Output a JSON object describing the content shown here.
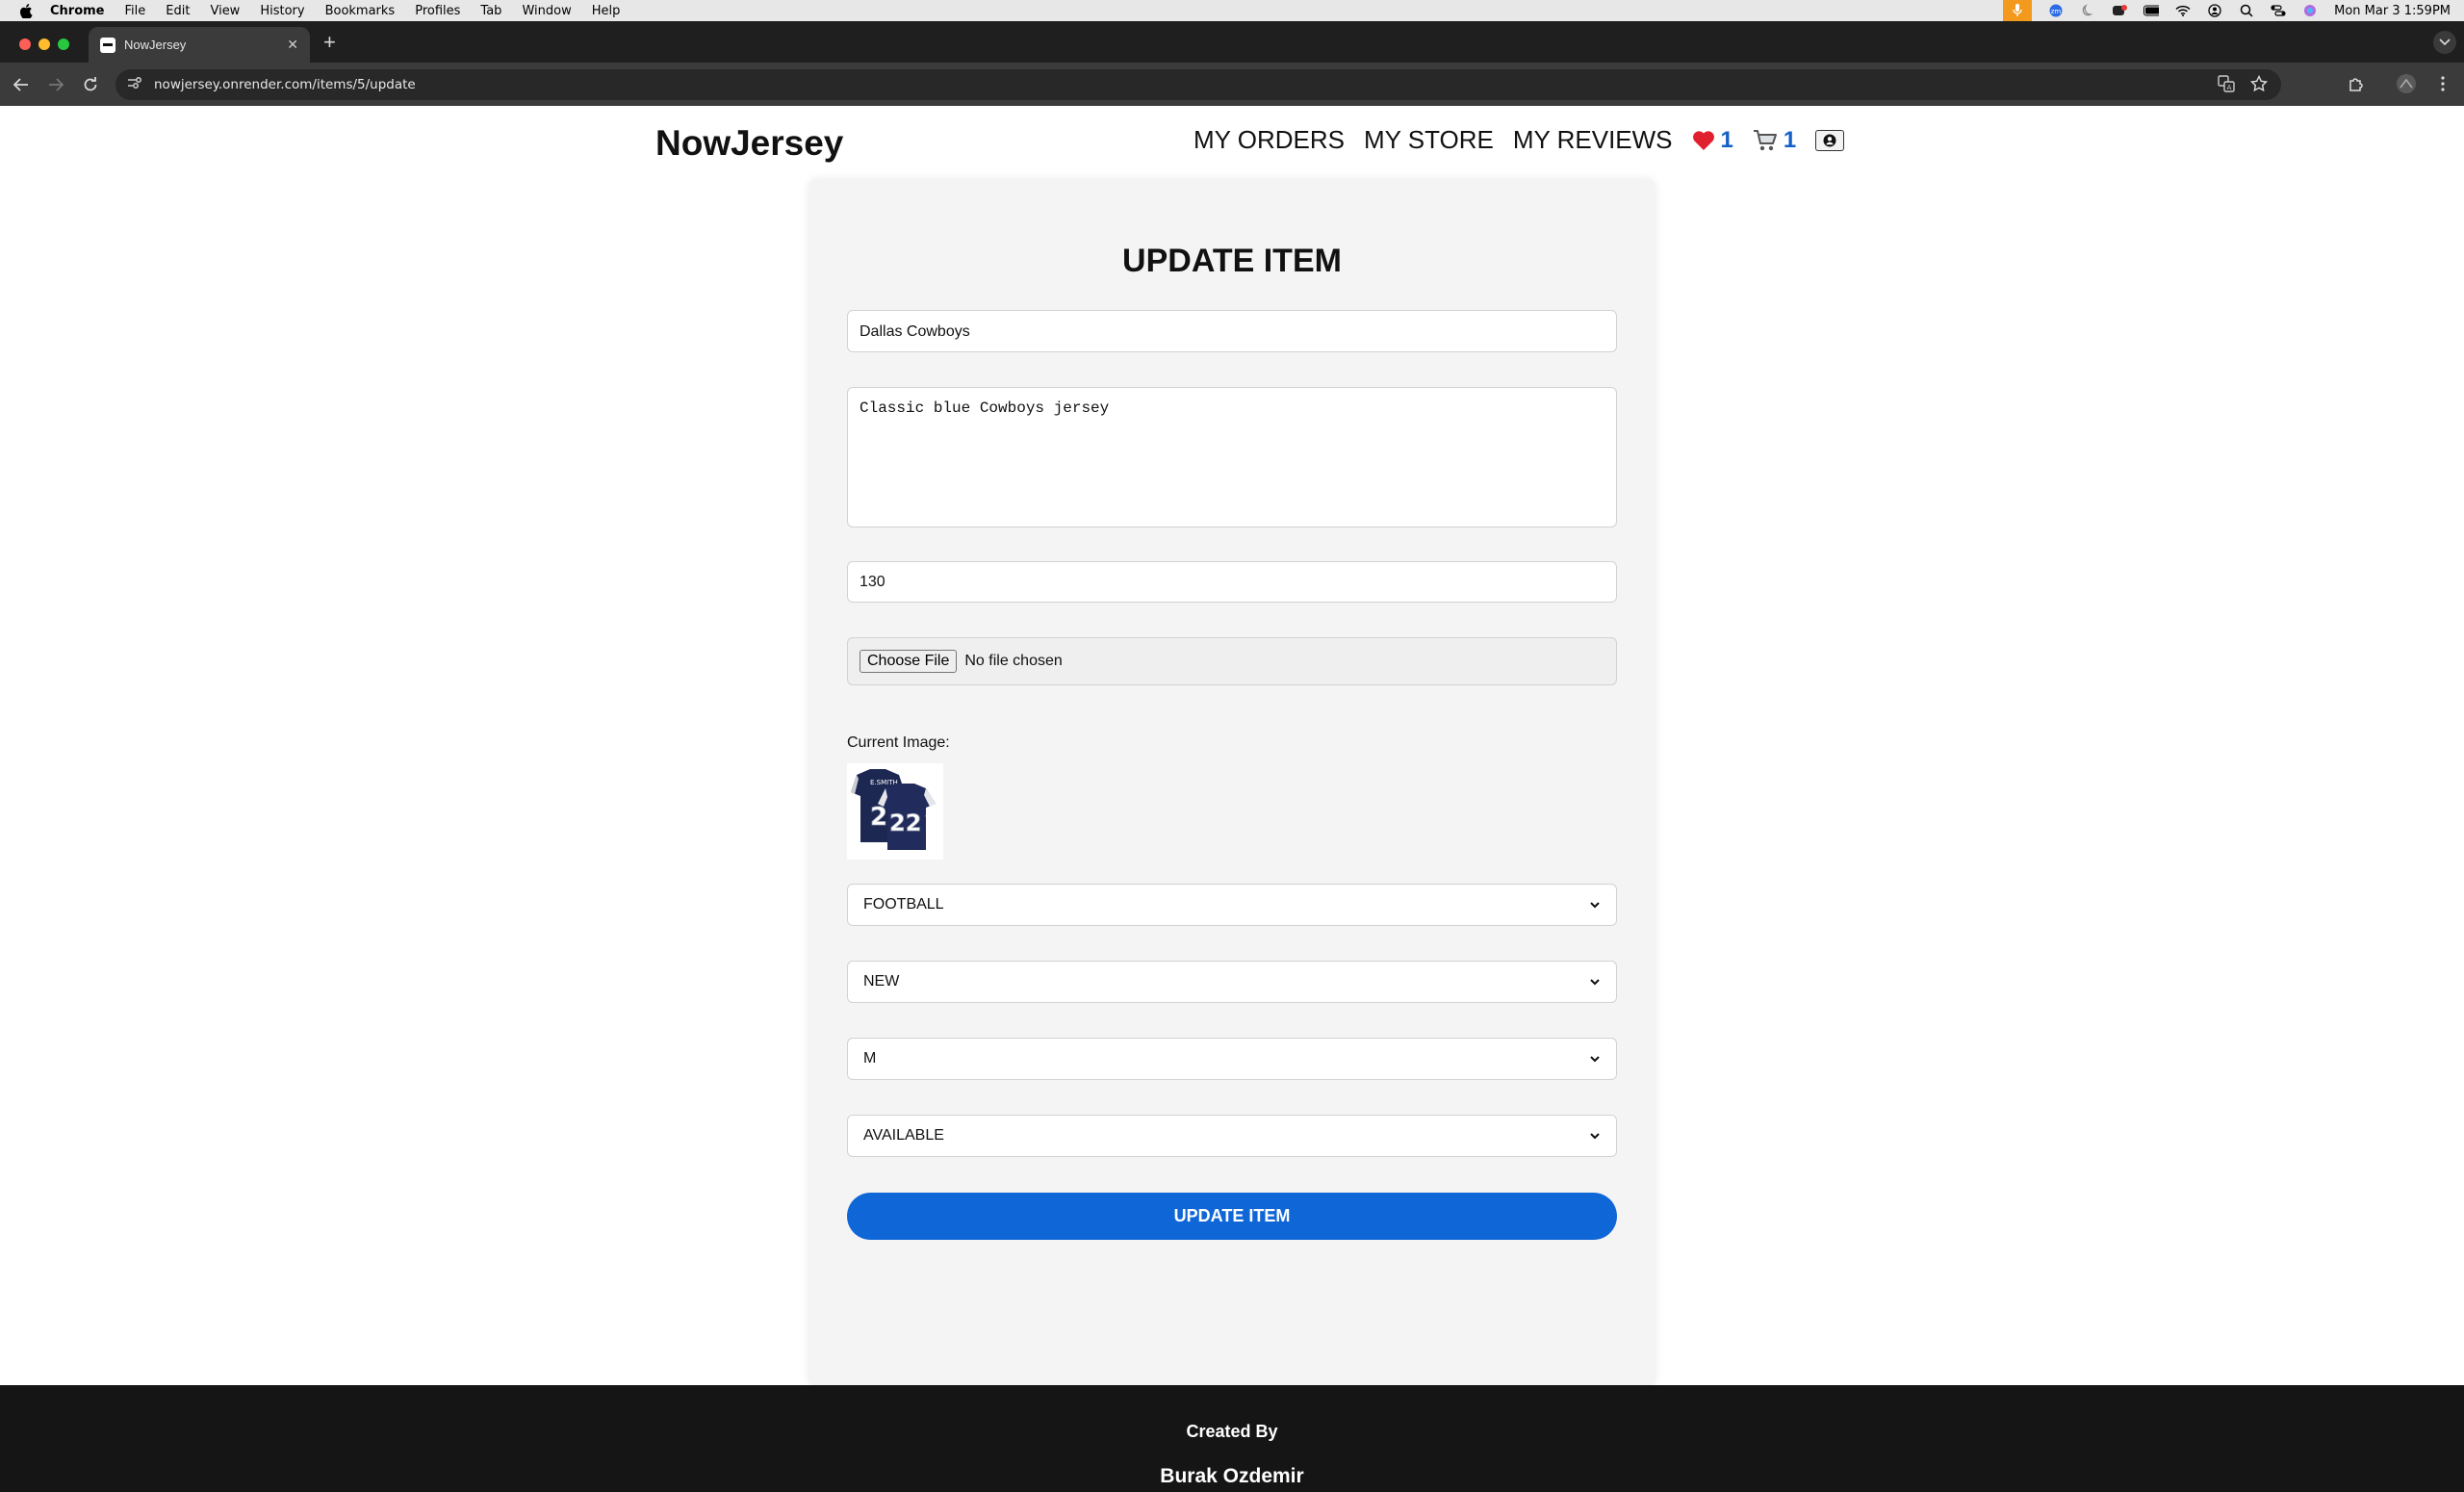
{
  "menubar": {
    "app": "Chrome",
    "items": [
      "File",
      "Edit",
      "View",
      "History",
      "Bookmarks",
      "Profiles",
      "Tab",
      "Window",
      "Help"
    ],
    "clock": "Mon Mar 3  1:59PM"
  },
  "browser": {
    "tab_title": "NowJersey",
    "url": "nowjersey.onrender.com/items/5/update"
  },
  "site": {
    "logo": "NowJersey",
    "nav": {
      "orders": "MY ORDERS",
      "store": "MY STORE",
      "reviews": "MY REVIEWS",
      "wishlist_count": "1",
      "cart_count": "1"
    }
  },
  "form": {
    "title": "UPDATE ITEM",
    "name_value": "Dallas Cowboys",
    "description_value": "Classic blue Cowboys jersey",
    "price_value": "130",
    "file_button": "Choose File",
    "file_status": "No file chosen",
    "current_image_label": "Current Image:",
    "category": "FOOTBALL",
    "condition": "NEW",
    "size": "M",
    "status": "AVAILABLE",
    "submit": "UPDATE ITEM"
  },
  "footer": {
    "created_by": "Created By",
    "author": "Burak Ozdemir"
  },
  "colors": {
    "primary_button": "#0f66d6",
    "counter": "#1360c7",
    "footer_bg": "#151515"
  }
}
